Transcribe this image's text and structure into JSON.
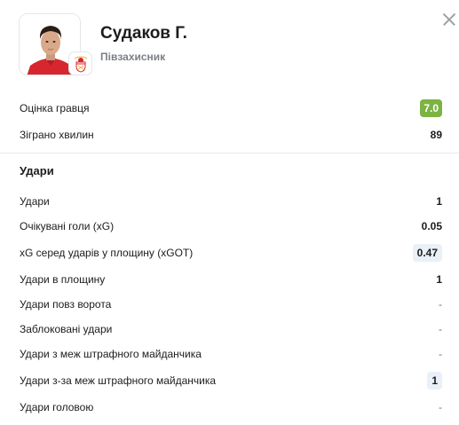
{
  "player": {
    "name": "Судаков Г.",
    "position": "Півзахисник",
    "photo_icon": "player-photo",
    "club_icon": "benfica-crest"
  },
  "summary": {
    "rating_label": "Оцінка гравця",
    "rating_value": "7.0",
    "rating_color": "#7cb342",
    "minutes_label": "Зіграно хвилин",
    "minutes_value": "89"
  },
  "shots_section": {
    "title": "Удари",
    "rows": [
      {
        "label": "Удари",
        "value": "1"
      },
      {
        "label": "Очікувані голи (xG)",
        "value": "0.05"
      },
      {
        "label": "xG серед ударів у площину (xGOT)",
        "value": "0.47"
      },
      {
        "label": "Удари в площину",
        "value": "1"
      },
      {
        "label": "Удари повз ворота",
        "value": "-"
      },
      {
        "label": "Заблоковані удари",
        "value": "-"
      },
      {
        "label": "Удари з меж штрафного майданчика",
        "value": "-"
      },
      {
        "label": "Удари з-за меж штрафного майданчика",
        "value": "1"
      },
      {
        "label": "Удари головою",
        "value": "-"
      }
    ]
  },
  "colors": {
    "highlight_chip": "#eaf0f8",
    "secondary_text": "#7a8087"
  }
}
